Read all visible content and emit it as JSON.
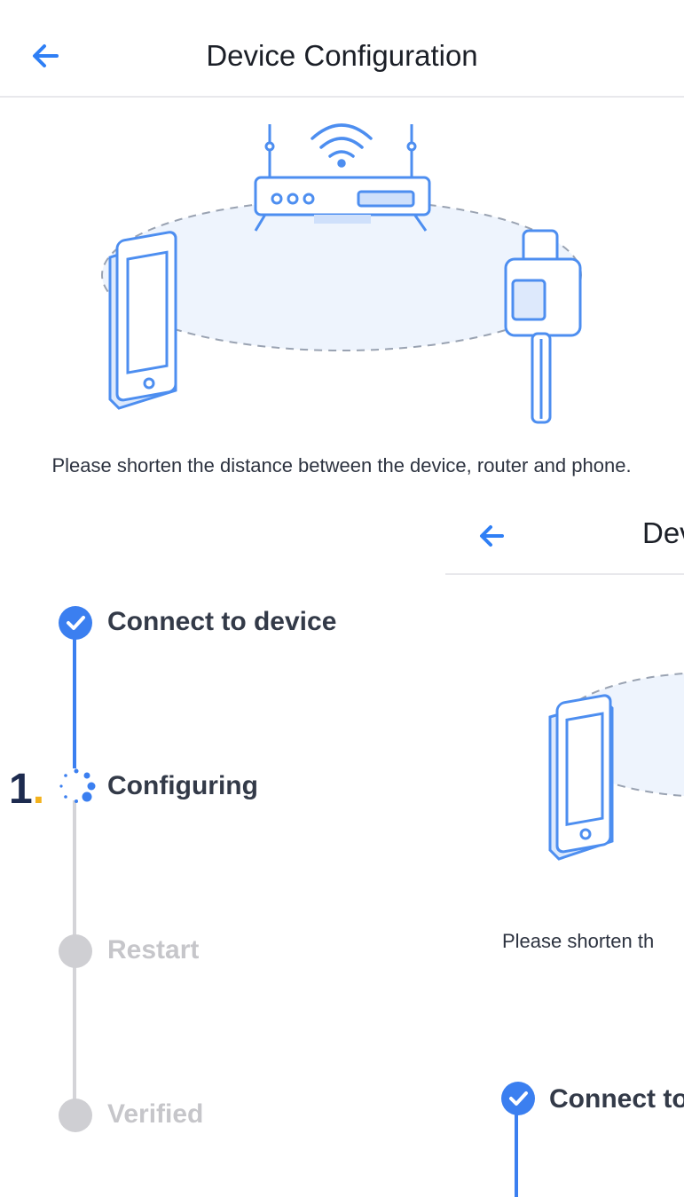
{
  "header": {
    "title": "Device Configuration"
  },
  "hint": "Please shorten the distance between the device, router and phone.",
  "steps": [
    {
      "label": "Connect to device",
      "status": "done"
    },
    {
      "label": "Configuring",
      "status": "in-progress"
    },
    {
      "label": "Restart",
      "status": "pending"
    },
    {
      "label": "Verified",
      "status": "pending"
    }
  ],
  "marker": {
    "number": "1",
    "dot": "."
  },
  "overlay": {
    "title": "Dev",
    "hint": "Please shorten th",
    "step_label": "Connect to"
  },
  "colors": {
    "accent": "#3b7ff0",
    "pending": "#cfcfd3",
    "text": "#333a48",
    "muted": "#c6c6ca"
  },
  "icons": [
    "back-arrow-icon",
    "router-icon",
    "wifi-icon",
    "phone-icon",
    "device-icon",
    "check-icon",
    "spinner-icon"
  ]
}
